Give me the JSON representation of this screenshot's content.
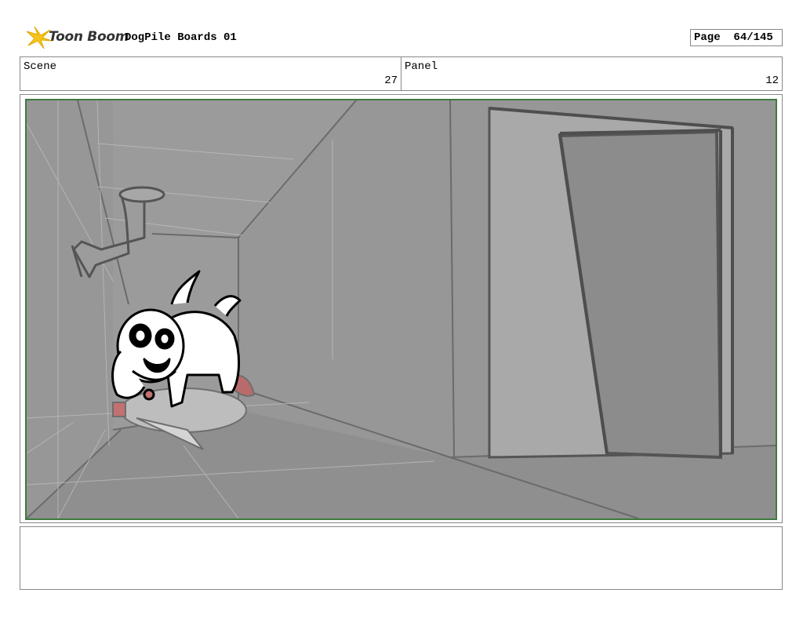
{
  "header": {
    "logo_text": "Toon Boom",
    "project_title": "DogPile Boards 01",
    "page_label": "Page",
    "page_number": "64/145"
  },
  "info": {
    "scene_label": "Scene",
    "scene_value": "27",
    "panel_label": "Panel",
    "panel_value": "12"
  },
  "panel": {
    "background_color": "#979797",
    "frame_color": "#3f7a3f"
  },
  "notes": {
    "text": ""
  }
}
